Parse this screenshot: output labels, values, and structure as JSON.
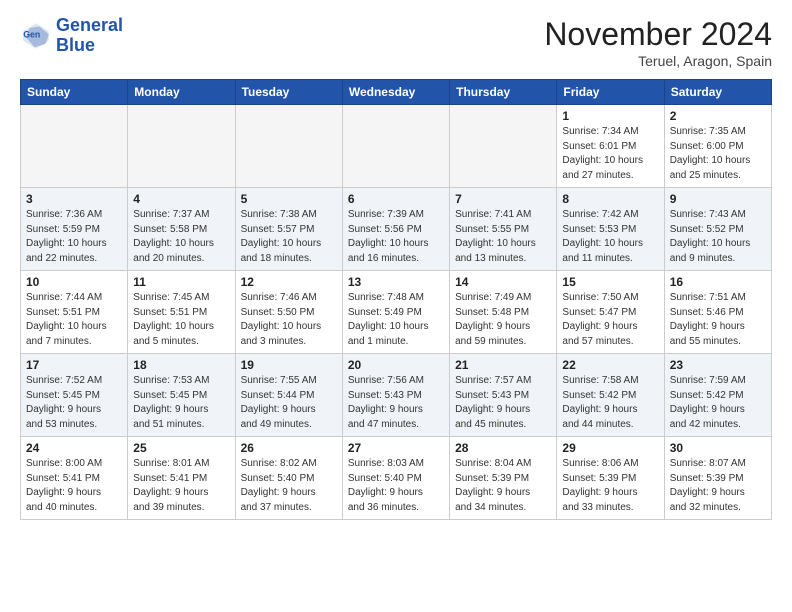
{
  "header": {
    "logo_line1": "General",
    "logo_line2": "Blue",
    "month": "November 2024",
    "location": "Teruel, Aragon, Spain"
  },
  "weekdays": [
    "Sunday",
    "Monday",
    "Tuesday",
    "Wednesday",
    "Thursday",
    "Friday",
    "Saturday"
  ],
  "weeks": [
    [
      {
        "day": "",
        "info": ""
      },
      {
        "day": "",
        "info": ""
      },
      {
        "day": "",
        "info": ""
      },
      {
        "day": "",
        "info": ""
      },
      {
        "day": "",
        "info": ""
      },
      {
        "day": "1",
        "info": "Sunrise: 7:34 AM\nSunset: 6:01 PM\nDaylight: 10 hours\nand 27 minutes."
      },
      {
        "day": "2",
        "info": "Sunrise: 7:35 AM\nSunset: 6:00 PM\nDaylight: 10 hours\nand 25 minutes."
      }
    ],
    [
      {
        "day": "3",
        "info": "Sunrise: 7:36 AM\nSunset: 5:59 PM\nDaylight: 10 hours\nand 22 minutes."
      },
      {
        "day": "4",
        "info": "Sunrise: 7:37 AM\nSunset: 5:58 PM\nDaylight: 10 hours\nand 20 minutes."
      },
      {
        "day": "5",
        "info": "Sunrise: 7:38 AM\nSunset: 5:57 PM\nDaylight: 10 hours\nand 18 minutes."
      },
      {
        "day": "6",
        "info": "Sunrise: 7:39 AM\nSunset: 5:56 PM\nDaylight: 10 hours\nand 16 minutes."
      },
      {
        "day": "7",
        "info": "Sunrise: 7:41 AM\nSunset: 5:55 PM\nDaylight: 10 hours\nand 13 minutes."
      },
      {
        "day": "8",
        "info": "Sunrise: 7:42 AM\nSunset: 5:53 PM\nDaylight: 10 hours\nand 11 minutes."
      },
      {
        "day": "9",
        "info": "Sunrise: 7:43 AM\nSunset: 5:52 PM\nDaylight: 10 hours\nand 9 minutes."
      }
    ],
    [
      {
        "day": "10",
        "info": "Sunrise: 7:44 AM\nSunset: 5:51 PM\nDaylight: 10 hours\nand 7 minutes."
      },
      {
        "day": "11",
        "info": "Sunrise: 7:45 AM\nSunset: 5:51 PM\nDaylight: 10 hours\nand 5 minutes."
      },
      {
        "day": "12",
        "info": "Sunrise: 7:46 AM\nSunset: 5:50 PM\nDaylight: 10 hours\nand 3 minutes."
      },
      {
        "day": "13",
        "info": "Sunrise: 7:48 AM\nSunset: 5:49 PM\nDaylight: 10 hours\nand 1 minute."
      },
      {
        "day": "14",
        "info": "Sunrise: 7:49 AM\nSunset: 5:48 PM\nDaylight: 9 hours\nand 59 minutes."
      },
      {
        "day": "15",
        "info": "Sunrise: 7:50 AM\nSunset: 5:47 PM\nDaylight: 9 hours\nand 57 minutes."
      },
      {
        "day": "16",
        "info": "Sunrise: 7:51 AM\nSunset: 5:46 PM\nDaylight: 9 hours\nand 55 minutes."
      }
    ],
    [
      {
        "day": "17",
        "info": "Sunrise: 7:52 AM\nSunset: 5:45 PM\nDaylight: 9 hours\nand 53 minutes."
      },
      {
        "day": "18",
        "info": "Sunrise: 7:53 AM\nSunset: 5:45 PM\nDaylight: 9 hours\nand 51 minutes."
      },
      {
        "day": "19",
        "info": "Sunrise: 7:55 AM\nSunset: 5:44 PM\nDaylight: 9 hours\nand 49 minutes."
      },
      {
        "day": "20",
        "info": "Sunrise: 7:56 AM\nSunset: 5:43 PM\nDaylight: 9 hours\nand 47 minutes."
      },
      {
        "day": "21",
        "info": "Sunrise: 7:57 AM\nSunset: 5:43 PM\nDaylight: 9 hours\nand 45 minutes."
      },
      {
        "day": "22",
        "info": "Sunrise: 7:58 AM\nSunset: 5:42 PM\nDaylight: 9 hours\nand 44 minutes."
      },
      {
        "day": "23",
        "info": "Sunrise: 7:59 AM\nSunset: 5:42 PM\nDaylight: 9 hours\nand 42 minutes."
      }
    ],
    [
      {
        "day": "24",
        "info": "Sunrise: 8:00 AM\nSunset: 5:41 PM\nDaylight: 9 hours\nand 40 minutes."
      },
      {
        "day": "25",
        "info": "Sunrise: 8:01 AM\nSunset: 5:41 PM\nDaylight: 9 hours\nand 39 minutes."
      },
      {
        "day": "26",
        "info": "Sunrise: 8:02 AM\nSunset: 5:40 PM\nDaylight: 9 hours\nand 37 minutes."
      },
      {
        "day": "27",
        "info": "Sunrise: 8:03 AM\nSunset: 5:40 PM\nDaylight: 9 hours\nand 36 minutes."
      },
      {
        "day": "28",
        "info": "Sunrise: 8:04 AM\nSunset: 5:39 PM\nDaylight: 9 hours\nand 34 minutes."
      },
      {
        "day": "29",
        "info": "Sunrise: 8:06 AM\nSunset: 5:39 PM\nDaylight: 9 hours\nand 33 minutes."
      },
      {
        "day": "30",
        "info": "Sunrise: 8:07 AM\nSunset: 5:39 PM\nDaylight: 9 hours\nand 32 minutes."
      }
    ]
  ]
}
